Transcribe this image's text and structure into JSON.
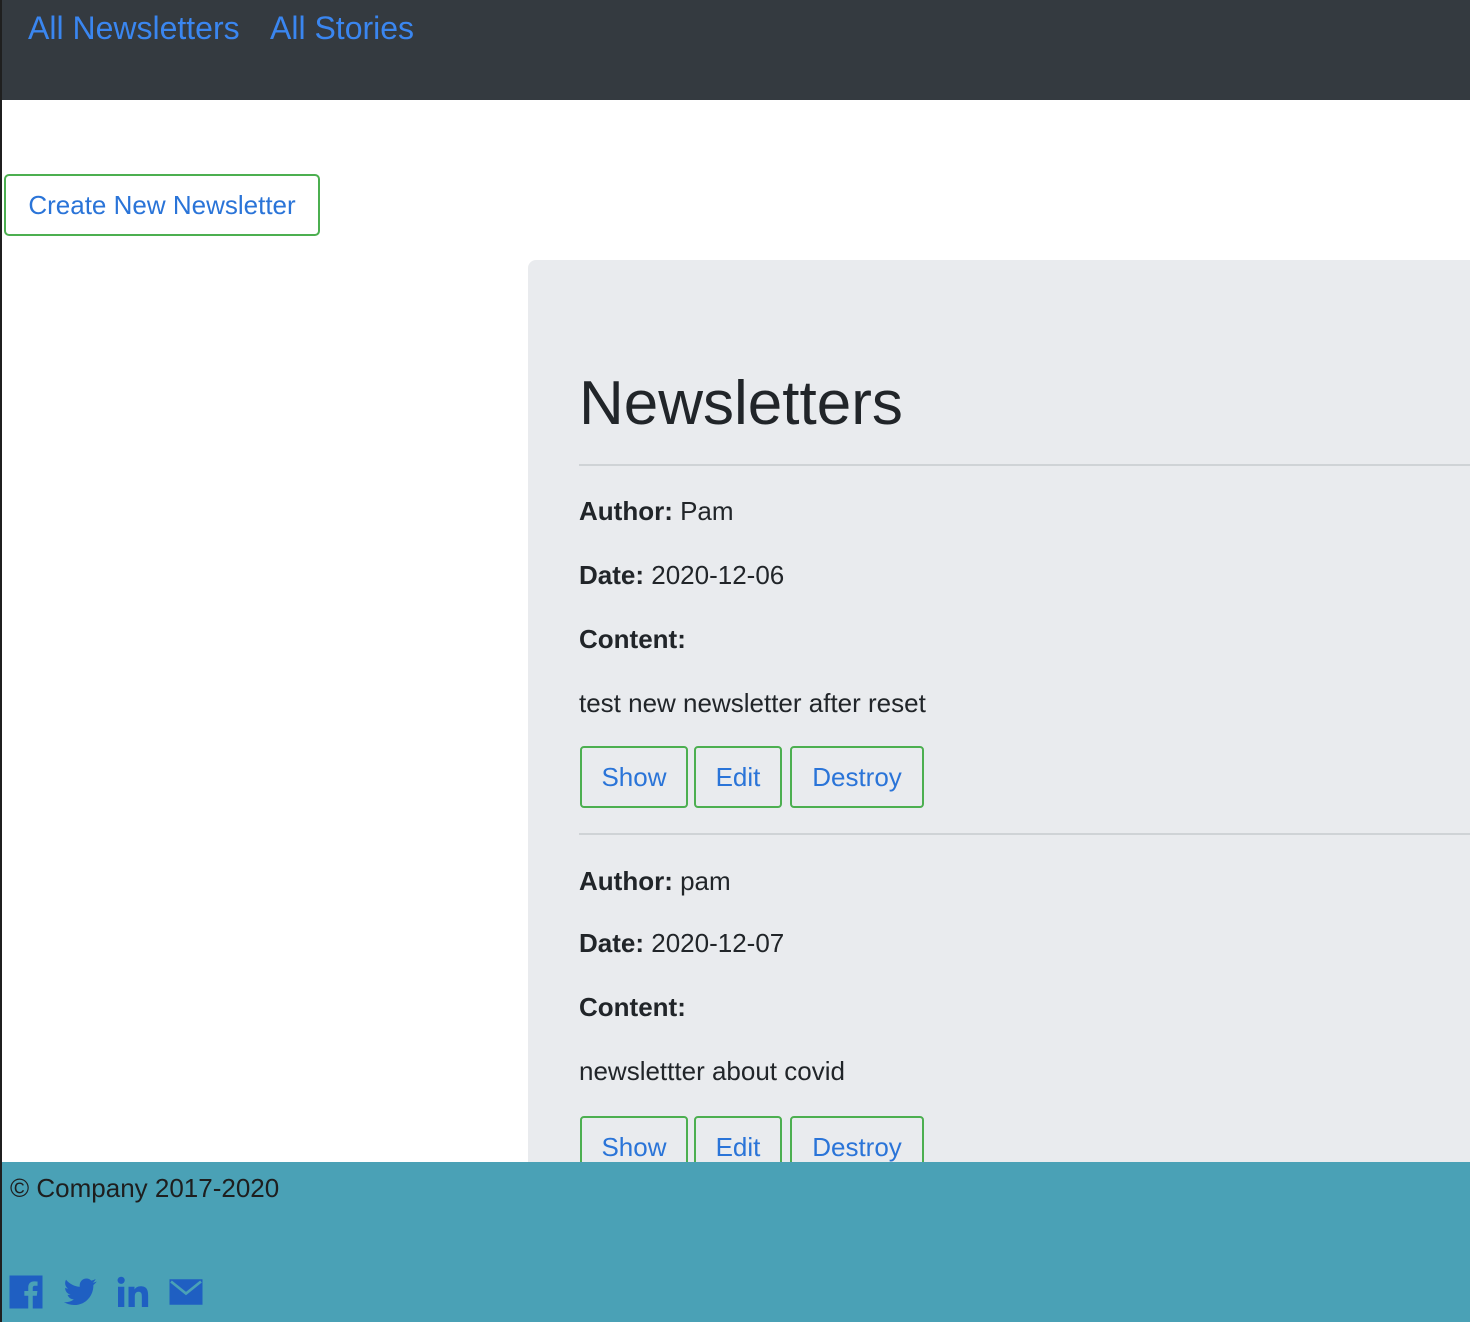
{
  "nav": {
    "links": [
      "All Newsletters",
      "All Stories"
    ]
  },
  "actions": {
    "create_label": "Create New Newsletter"
  },
  "main": {
    "title": "Newsletters",
    "labels": {
      "author": "Author:",
      "date": "Date:",
      "content": "Content:"
    },
    "newsletters": [
      {
        "author": "Pam",
        "date": "2020-12-06",
        "content": "test new newsletter after reset",
        "buttons": [
          "Show",
          "Edit",
          "Destroy"
        ]
      },
      {
        "author": "pam",
        "date": "2020-12-07",
        "content": "newslettter about covid",
        "buttons": [
          "Show",
          "Edit",
          "Destroy"
        ]
      }
    ]
  },
  "footer": {
    "copyright": "© Company 2017-2020",
    "social_icons": [
      "facebook-icon",
      "twitter-icon",
      "linkedin-icon",
      "email-icon"
    ]
  },
  "colors": {
    "navbar": "#343a40",
    "link": "#3a86f0",
    "button_border": "#4caf50",
    "card_bg": "#e9ebee",
    "footer_bg": "#4aa1b6",
    "icon": "#1f5fc2"
  }
}
